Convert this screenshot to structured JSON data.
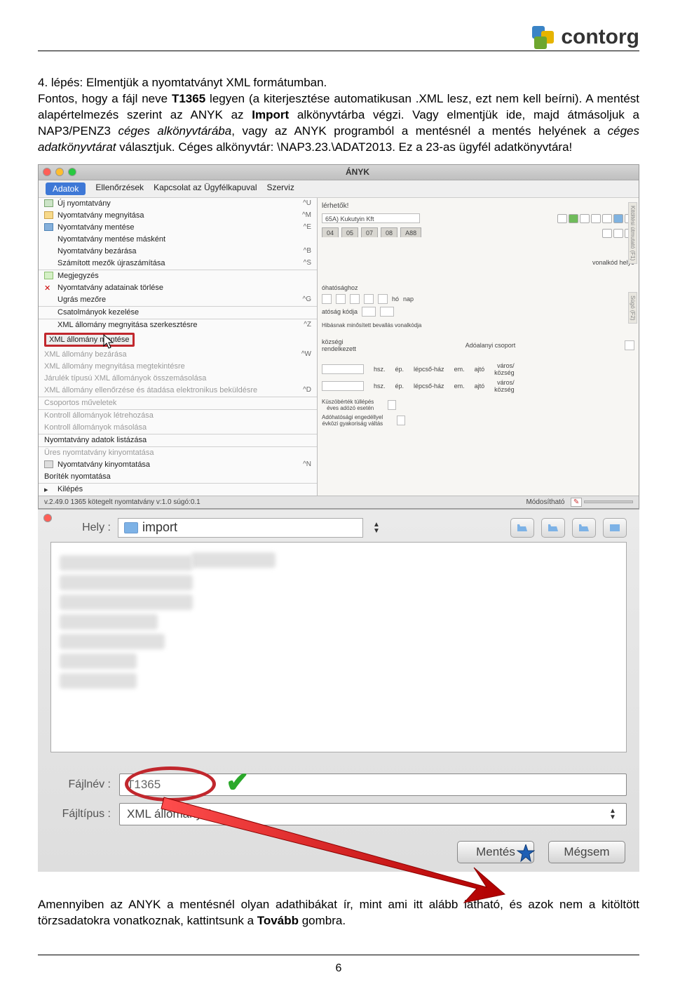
{
  "header": {
    "brand": "contorg"
  },
  "paragraph1": {
    "t1": "4. lépés: Elmentjük a nyomtatványt XML formátumban.",
    "t2": "Fontos, hogy a fájl neve ",
    "t3": "T1365",
    "t4": " legyen (a kiterjesztése automatikusan ",
    "t5": ".XML",
    "t6": " lesz, ezt nem kell beírni). A mentést alapértelmezés szerint az ANYK az ",
    "t7": "Import",
    "t8": " alkönyvtárba végzi. Vagy elmentjük ide, majd átmásoljuk a NAP3/PENZ3 ",
    "t9": "céges alkönyvtárába",
    "t10": ", vagy az ANYK programból a mentésnél a mentés helyének a ",
    "t11": "céges adatkönyvtárat",
    "t12": " választjuk. Céges alkönyvtár: \\NAP3.23.\\ADAT2013. Ez a 23-as ügyfél adatkönyvtára!"
  },
  "anyk": {
    "title": "ÁNYK",
    "menubar": [
      "Adatok",
      "Ellenőrzések",
      "Kapcsolat az Ügyfélkapuval",
      "Szerviz"
    ],
    "menu": {
      "items": [
        {
          "label": "Új nyomtatvány",
          "sc": "^U"
        },
        {
          "label": "Nyomtatvány megnyitása",
          "sc": "^M"
        },
        {
          "label": "Nyomtatvány mentése",
          "sc": "^E"
        },
        {
          "label": "Nyomtatvány mentése másként",
          "sc": ""
        },
        {
          "label": "Nyomtatvány bezárása",
          "sc": "^B"
        },
        {
          "label": "Számított mezők újraszámítása",
          "sc": "^S"
        }
      ],
      "items2": [
        {
          "label": "Megjegyzés",
          "sc": ""
        },
        {
          "label": "Nyomtatvány adatainak törlése",
          "sc": ""
        },
        {
          "label": "Ugrás mezőre",
          "sc": "^G"
        }
      ],
      "items3": [
        {
          "label": "Csatolmányok kezelése",
          "sc": ""
        }
      ],
      "items4": [
        {
          "label": "XML állomány megnyitása szerkesztésre",
          "sc": "^Z",
          "gray": false
        },
        {
          "label": "XML állomány mentése",
          "sc": "",
          "hil": true
        },
        {
          "label": "XML állomány bezárása",
          "sc": "^W",
          "gray": true
        },
        {
          "label": "XML állomány megnyitása megtekintésre",
          "sc": "",
          "gray": true
        },
        {
          "label": "Járulék típusú XML állományok összemásolása",
          "sc": "",
          "gray": true
        },
        {
          "label": "XML állomány ellenőrzése és átadása elektronikus beküldésre",
          "sc": "^D",
          "gray": true
        }
      ],
      "items5": [
        {
          "label": "Csoportos műveletek",
          "sc": "",
          "gray": true
        }
      ],
      "items6": [
        {
          "label": "Kontroll állományok létrehozása",
          "sc": "",
          "gray": true
        },
        {
          "label": "Kontroll állományok másolása",
          "sc": "",
          "gray": true
        }
      ],
      "items7": [
        {
          "label": "Nyomtatvány adatok listázása",
          "sc": "",
          "gray": false
        }
      ],
      "items8": [
        {
          "label": "Üres nyomtatvány kinyomtatása",
          "sc": "",
          "gray": true
        },
        {
          "label": "Nyomtatvány kinyomtatása",
          "sc": "^N"
        },
        {
          "label": "Boríték nyomtatása",
          "sc": ""
        }
      ],
      "items9": [
        {
          "label": "Kilépés",
          "sc": ""
        }
      ]
    },
    "right": {
      "lerhetok": "lérhetők!",
      "company": "65A) Kukutyin Kft",
      "tabs": [
        "04",
        "05",
        "07",
        "08",
        "A88"
      ],
      "vonalkod": "vonalkód helye",
      "hat": "óhatósághoz",
      "ho": "hó",
      "nap": "nap",
      "atosag": "atóság kódja",
      "hibas": "Hibásnak minősített bevallás vonalkódja",
      "kozseg": "községi",
      "rendel": "rendelkezett",
      "adoalanyi": "Adóalanyi csoport",
      "hsz": "hsz.",
      "ep": "ép.",
      "lepcso": "lépcső-ház",
      "em": "em.",
      "ajto": "ajtó",
      "varos": "város/\nközség",
      "kuszob": "Küszöbérték túllépés\néves adózó esetén",
      "adohat": "Adóhatósági engedéllyel\névközi gyakoriság váltás",
      "side1": "Kitöltési útmutató (F1)",
      "side2": "Súgó (F2)"
    },
    "status": {
      "left": "v.2.49.0   1365 kötegelt nyomtatvány v:1.0 súgó:0.1",
      "right": "Módosítható"
    }
  },
  "savedlg": {
    "hely_label": "Hely :",
    "hely_value": "import",
    "fajlnev_label": "Fájlnév :",
    "fajlnev_value": "T1365",
    "fajltipus_label": "Fájltípus :",
    "fajltipus_value": "XML állományok",
    "btn_save": "Mentés",
    "btn_cancel": "Mégsem"
  },
  "paragraph2": {
    "t1": "Amennyiben az ANYK a mentésnél olyan adathibákat ír, mint ami itt alább látható, és azok nem a kitöltött törzsadatokra vonatkoznak, kattintsunk a ",
    "t2": "Tovább",
    "t3": " gombra."
  },
  "footer": {
    "page": "6"
  }
}
